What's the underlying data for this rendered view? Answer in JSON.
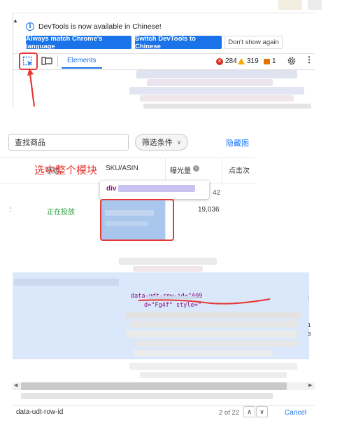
{
  "devtools": {
    "notice_text": "DevTools is now available in Chinese!",
    "btn_match_language": "Always match Chrome's language",
    "btn_switch": "Switch DevTools to Chinese",
    "btn_dont_show": "Don't show again",
    "tab_elements": "Elements",
    "errors": "284",
    "warnings": "319",
    "issues": "1"
  },
  "table_panel": {
    "search_value": "查找商品",
    "filter_label": "筛选条件",
    "hide_link": "隐藏图",
    "annotation": "选中整个模块",
    "col_status": "状态",
    "col_sku": "SKU/ASIN",
    "col_impressions": "曝光量",
    "col_clicks": "点击次",
    "popup_tag": "div",
    "popup_value": "42",
    "row_status": "正在投放",
    "row_impressions": "19,036"
  },
  "code_panel": {
    "attr_line": "data-udt-row-id=\"A09",
    "second_line": "d=\"Fg4f\" style=\"",
    "search_value": "data-udt-row-id",
    "match_count": "2 of 22",
    "cancel_label": "Cancel"
  },
  "colors": {
    "accent_blue": "#1a73e8",
    "annotation_red": "#e53935",
    "highlight_blue": "#a9c7ec",
    "status_green": "#2a9d3f"
  }
}
